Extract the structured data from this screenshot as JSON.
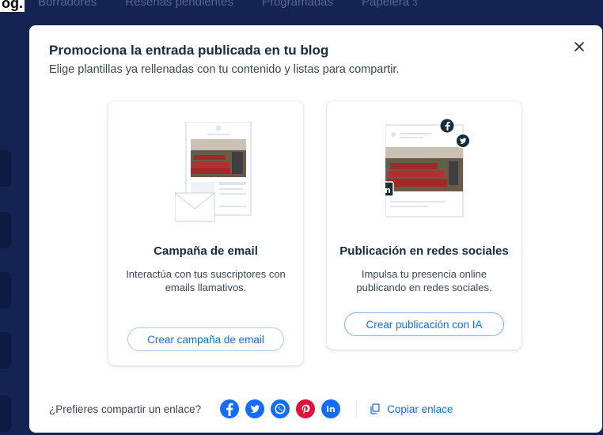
{
  "background": {
    "corner_text": "og.",
    "tabs": [
      "Borradores",
      "Reseñas pendientes",
      "Programadas",
      "Papelera"
    ],
    "trash_count": "3"
  },
  "modal": {
    "title": "Promociona la entrada publicada en tu blog",
    "subtitle": "Elige plantillas ya rellenadas con tu contenido y listas para compartir.",
    "close_icon": "close-icon"
  },
  "cards": {
    "email": {
      "title": "Campaña de email",
      "description": "Interactúa con tus suscriptores con emails llamativos.",
      "button": "Crear campaña de email"
    },
    "social": {
      "title": "Publicación en redes sociales",
      "description": "Impulsa tu presencia online publicando en redes sociales.",
      "button": "Crear publicación con IA"
    }
  },
  "footer": {
    "label": "¿Prefieres compartir un enlace?",
    "icons": [
      "facebook-icon",
      "twitter-icon",
      "whatsapp-icon",
      "pinterest-icon",
      "linkedin-icon"
    ],
    "copy_link": "Copiar enlace"
  },
  "colors": {
    "accent": "#116dff",
    "title": "#162d3d",
    "backdrop": "#152353",
    "facebook": "#116dff",
    "twitter": "#116dff",
    "whatsapp": "#116dff",
    "pinterest": "#e0123b",
    "linkedin": "#116dff"
  }
}
